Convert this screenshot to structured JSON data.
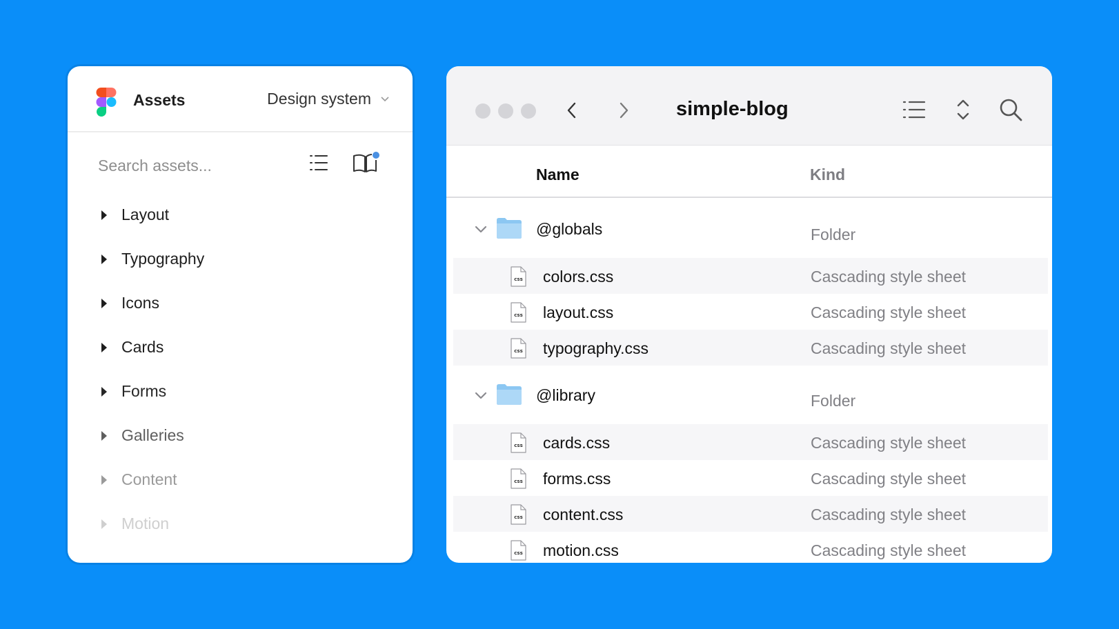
{
  "assets_panel": {
    "title": "Assets",
    "library_dropdown": "Design system",
    "search": {
      "placeholder": "Search assets...",
      "value": ""
    },
    "sections": [
      {
        "label": "Layout",
        "color": "#1e1e1e"
      },
      {
        "label": "Typography",
        "color": "#1e1e1e"
      },
      {
        "label": "Icons",
        "color": "#1e1e1e"
      },
      {
        "label": "Cards",
        "color": "#1e1e1e"
      },
      {
        "label": "Forms",
        "color": "#262626"
      },
      {
        "label": "Galleries",
        "color": "#5e5e5e"
      },
      {
        "label": "Content",
        "color": "#9a9a9a"
      },
      {
        "label": "Motion",
        "color": "#cfcfcf"
      }
    ],
    "icons": [
      "figma-logo",
      "list-view-icon",
      "library-book-icon"
    ],
    "accent_color": "#4a90e2"
  },
  "finder": {
    "title": "simple-blog",
    "columns": {
      "name": "Name",
      "kind": "Kind"
    },
    "groups": [
      {
        "name": "@globals",
        "kind": "Folder",
        "files": [
          {
            "name": "colors.css",
            "kind": "Cascading style sheet"
          },
          {
            "name": "layout.css",
            "kind": "Cascading style sheet"
          },
          {
            "name": "typography.css",
            "kind": "Cascading style sheet"
          }
        ]
      },
      {
        "name": "@library",
        "kind": "Folder",
        "files": [
          {
            "name": "cards.css",
            "kind": "Cascading style sheet"
          },
          {
            "name": "forms.css",
            "kind": "Cascading style sheet"
          },
          {
            "name": "content.css",
            "kind": "Cascading style sheet"
          },
          {
            "name": "motion.css",
            "kind": "Cascading style sheet"
          }
        ]
      }
    ],
    "file_badge": "css",
    "icons": [
      "back-chevron-icon",
      "forward-chevron-icon",
      "list-view-icon",
      "sort-icon",
      "search-icon",
      "folder-icon",
      "css-file-icon"
    ]
  },
  "colors": {
    "background": "#0a8ef9",
    "folder": "#a9d6f6"
  }
}
